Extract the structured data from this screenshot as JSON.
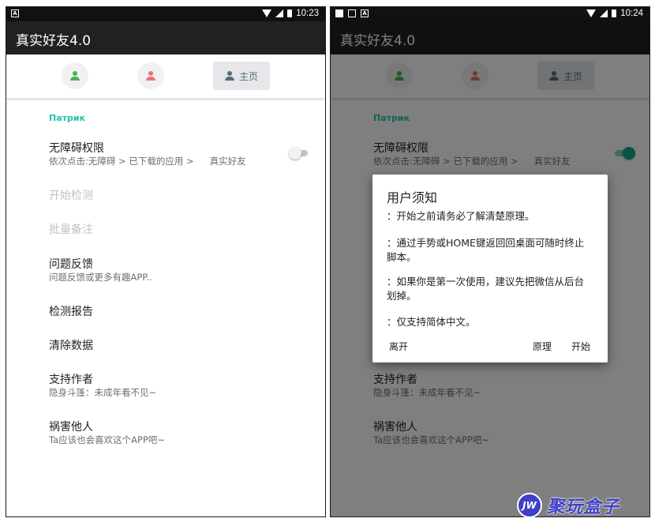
{
  "left": {
    "statusbar": {
      "time": "10:23",
      "notif_icons": [
        "A"
      ]
    },
    "appbar": {
      "title": "真实好友4.0"
    },
    "tabs": {
      "home_label": "主页"
    },
    "section_header": "Патрик",
    "items": [
      {
        "title": "无障碍权限",
        "sub": "依次点击:无障碍 > 已下载的应用 >",
        "sub_extra": "真实好友"
      },
      {
        "title": "开始检测"
      },
      {
        "title": "批量备注"
      },
      {
        "title": "问题反馈",
        "sub": "问题反馈或更多有趣APP.."
      },
      {
        "title": "检测报告"
      },
      {
        "title": "清除数据"
      },
      {
        "title": "支持作者",
        "sub": "隐身斗篷：未成年看不见~"
      },
      {
        "title": "祸害他人",
        "sub": "Ta应该也会喜欢这个APP吧~"
      }
    ]
  },
  "right": {
    "statusbar": {
      "time": "10:24",
      "notif_icons": [
        "",
        "",
        "A"
      ]
    },
    "appbar": {
      "title": "真实好友4.0"
    },
    "tabs": {
      "home_label": "主页"
    },
    "section_header": "Патрик",
    "items": [
      {
        "title": "无障碍权限",
        "sub": "依次点击:无障碍 > 已下载的应用 >",
        "sub_extra": "真实好友"
      },
      {
        "title": "支持作者",
        "sub": "隐身斗篷：未成年看不见~"
      },
      {
        "title": "祸害他人",
        "sub": "Ta应该也会喜欢这个APP吧~"
      }
    ],
    "dialog": {
      "title": "用户须知",
      "lines": [
        "：开始之前请务必了解清楚原理。",
        "：通过手势或HOME键返回回桌面可随时终止脚本。",
        "：如果你是第一次使用，建议先把微信从后台划掉。",
        "：仅支持简体中文。"
      ],
      "leave_label": "离开",
      "principle_label": "原理",
      "start_label": "开始"
    }
  },
  "watermark": {
    "logo_text": "JW",
    "text": "聚玩盒子"
  },
  "colors": {
    "accent": "#1ec4a8",
    "switch_on": "#10a88f",
    "tab_green": "#4caf50",
    "tab_red": "#e57373",
    "tab_grey": "#546e7a",
    "appbar": "#212121"
  }
}
